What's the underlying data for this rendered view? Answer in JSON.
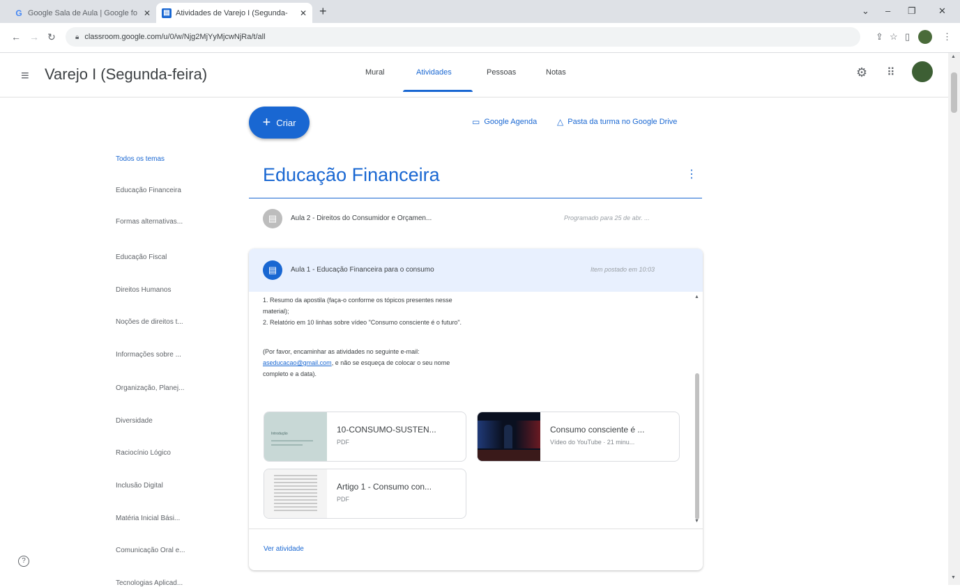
{
  "browser": {
    "tabs": [
      {
        "title": "Google Sala de Aula | Google fo",
        "favicon": "G"
      },
      {
        "title": "Atividades de Varejo I (Segunda-",
        "favicon": "▤"
      }
    ],
    "url": "classroom.google.com/u/0/w/Njg2MjYyMjcwNjRa/t/all"
  },
  "header": {
    "class_title": "Varejo I (Segunda-feira)",
    "tabs": [
      "Mural",
      "Atividades",
      "Pessoas",
      "Notas"
    ],
    "active_tab": "Atividades"
  },
  "sidebar": {
    "topics": [
      "Todos os temas",
      "Educação Financeira",
      "Formas alternativas...",
      "Educação Fiscal",
      "Direitos Humanos",
      "Noções de direitos t...",
      "Informações sobre ...",
      "Organização, Planej...",
      "Diversidade",
      "Raciocínio Lógico",
      "Inclusão Digital",
      "Matéria Inicial Bási...",
      "Comunicação Oral e...",
      "Tecnologias Aplicad..."
    ]
  },
  "main": {
    "create_label": "Criar",
    "calendar_link": "Google Agenda",
    "drive_link": "Pasta da turma no Google Drive",
    "section_title": "Educação Financeira",
    "item1": {
      "title": "Aula 2 - Direitos do Consumidor e Orçamen...",
      "meta": "Programado para 25 de abr. ..."
    },
    "item2": {
      "title": "Aula 1 - Educação Financeira para o consumo",
      "meta": "Item postado em 10:03",
      "body": {
        "line1": "1. Resumo da apostila (faça-o conforme os tópicos presentes nesse",
        "line2": "material);",
        "line3": "2. Relatório em 10 linhas sobre vídeo \"Consumo consciente é o futuro\".",
        "line4": "(Por favor, encaminhar as atividades no seguinte e-mail:",
        "email": "aseducacao@gmail.com",
        "line5_rest": ", e não se esqueça de colocar o seu nome",
        "line6": "completo e a data)."
      },
      "attachments": [
        {
          "title": "10-CONSUMO-SUSTEN...",
          "sub": "PDF",
          "thumb_label": "Introdução"
        },
        {
          "title": "Consumo consciente é ...",
          "sub": "Vídeo do YouTube · 21 minu..."
        },
        {
          "title": "Artigo 1 - Consumo con...",
          "sub": "PDF"
        }
      ],
      "view_label": "Ver atividade"
    }
  },
  "colors": {
    "accent": "#1967d2",
    "header_bg": "#e8f0fe"
  }
}
